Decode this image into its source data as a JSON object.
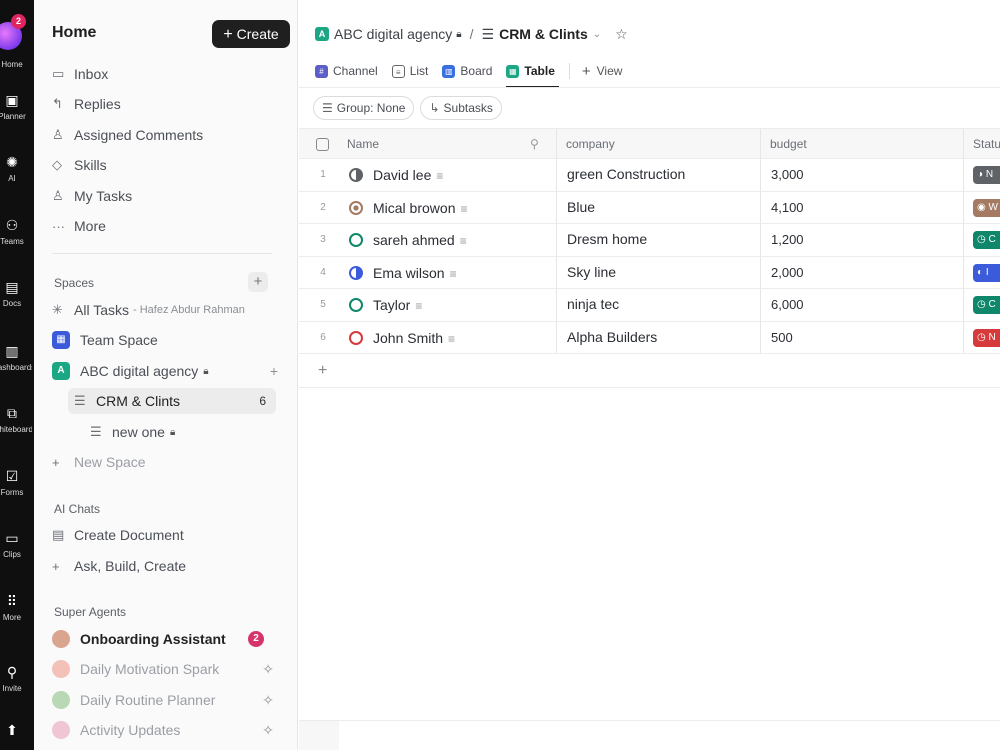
{
  "rail": {
    "badge": "2",
    "items": [
      {
        "icon": "home-icon",
        "label": "Home"
      },
      {
        "icon": "planner-icon",
        "label": "Planner"
      },
      {
        "icon": "ai-icon",
        "label": "AI"
      },
      {
        "icon": "teams-icon",
        "label": "Teams"
      },
      {
        "icon": "docs-icon",
        "label": "Docs"
      },
      {
        "icon": "dashboards-icon",
        "label": "Dashboards"
      },
      {
        "icon": "whiteboards-icon",
        "label": "Whiteboards"
      },
      {
        "icon": "forms-icon",
        "label": "Forms"
      },
      {
        "icon": "clips-icon",
        "label": "Clips"
      },
      {
        "icon": "more-icon",
        "label": "More"
      },
      {
        "icon": "invite-icon",
        "label": "Invite"
      }
    ]
  },
  "sidebar": {
    "title": "Home",
    "create_label": "Create",
    "nav": [
      {
        "label": "Inbox",
        "icon": "inbox-icon"
      },
      {
        "label": "Replies",
        "icon": "reply-icon"
      },
      {
        "label": "Assigned Comments",
        "icon": "comment-user-icon"
      },
      {
        "label": "Skills",
        "icon": "diamond-icon"
      },
      {
        "label": "My Tasks",
        "icon": "user-icon"
      },
      {
        "label": "More",
        "icon": "ellipsis-icon"
      }
    ],
    "spaces_label": "Spaces",
    "all_tasks": {
      "label": "All Tasks",
      "owner": "- Hafez Abdur Rahman"
    },
    "team_space": "Team Space",
    "agency": {
      "label": "ABC digital agency",
      "letter": "A"
    },
    "crm": {
      "label": "CRM & Clints",
      "count": "6"
    },
    "new_one": "new one",
    "new_space": "New Space",
    "ai_chats_label": "AI Chats",
    "create_document": "Create Document",
    "ask_build": "Ask, Build, Create",
    "super_agents_label": "Super Agents",
    "agents": [
      {
        "label": "Onboarding Assistant",
        "badge": "2"
      },
      {
        "label": "Daily Motivation Spark"
      },
      {
        "label": "Daily Routine Planner"
      },
      {
        "label": "Activity Updates"
      }
    ]
  },
  "main": {
    "breadcrumb": {
      "space": "ABC digital agency",
      "space_letter": "A",
      "separator": "/",
      "list": "CRM & Clints"
    },
    "views": [
      {
        "label": "Channel",
        "icon": "channel-icon",
        "color": "#5b5fc7"
      },
      {
        "label": "List",
        "icon": "list-icon",
        "color": "#555"
      },
      {
        "label": "Board",
        "icon": "board-icon",
        "color": "#3a6fe0"
      },
      {
        "label": "Table",
        "icon": "table-icon",
        "color": "#1ba784",
        "active": true
      }
    ],
    "add_view": "View",
    "chips": [
      {
        "label": "Group: None",
        "icon": "layers-icon"
      },
      {
        "label": "Subtasks",
        "icon": "subtask-icon"
      }
    ]
  },
  "table": {
    "columns": [
      "Name",
      "company",
      "budget",
      "Status"
    ],
    "rows": [
      {
        "idx": "1",
        "name": "David lee",
        "company": "green Construction",
        "budget": "3,000",
        "status_color": "#5f6368",
        "status_letter": "N"
      },
      {
        "idx": "2",
        "name": "Mical browon",
        "company": "Blue",
        "budget": "4,100",
        "status_color": "#a47a62",
        "status_letter": "W"
      },
      {
        "idx": "3",
        "name": "sareh ahmed",
        "company": "Dresm home",
        "budget": "1,200",
        "status_color": "#10876a",
        "status_letter": "C"
      },
      {
        "idx": "4",
        "name": "Ema wilson",
        "company": "Sky line",
        "budget": "2,000",
        "status_color": "#3b5bdb",
        "status_letter": "I"
      },
      {
        "idx": "5",
        "name": "Taylor",
        "company": "ninja tec",
        "budget": "6,000",
        "status_color": "#10876a",
        "status_letter": "C"
      },
      {
        "idx": "6",
        "name": "John Smith",
        "company": "Alpha Builders",
        "budget": "500",
        "status_color": "#d63a3a",
        "status_letter": "N"
      }
    ]
  },
  "colors": {
    "accent": "#1ba784",
    "rail_bg": "#0f0f10",
    "notif": "#d6336c"
  }
}
